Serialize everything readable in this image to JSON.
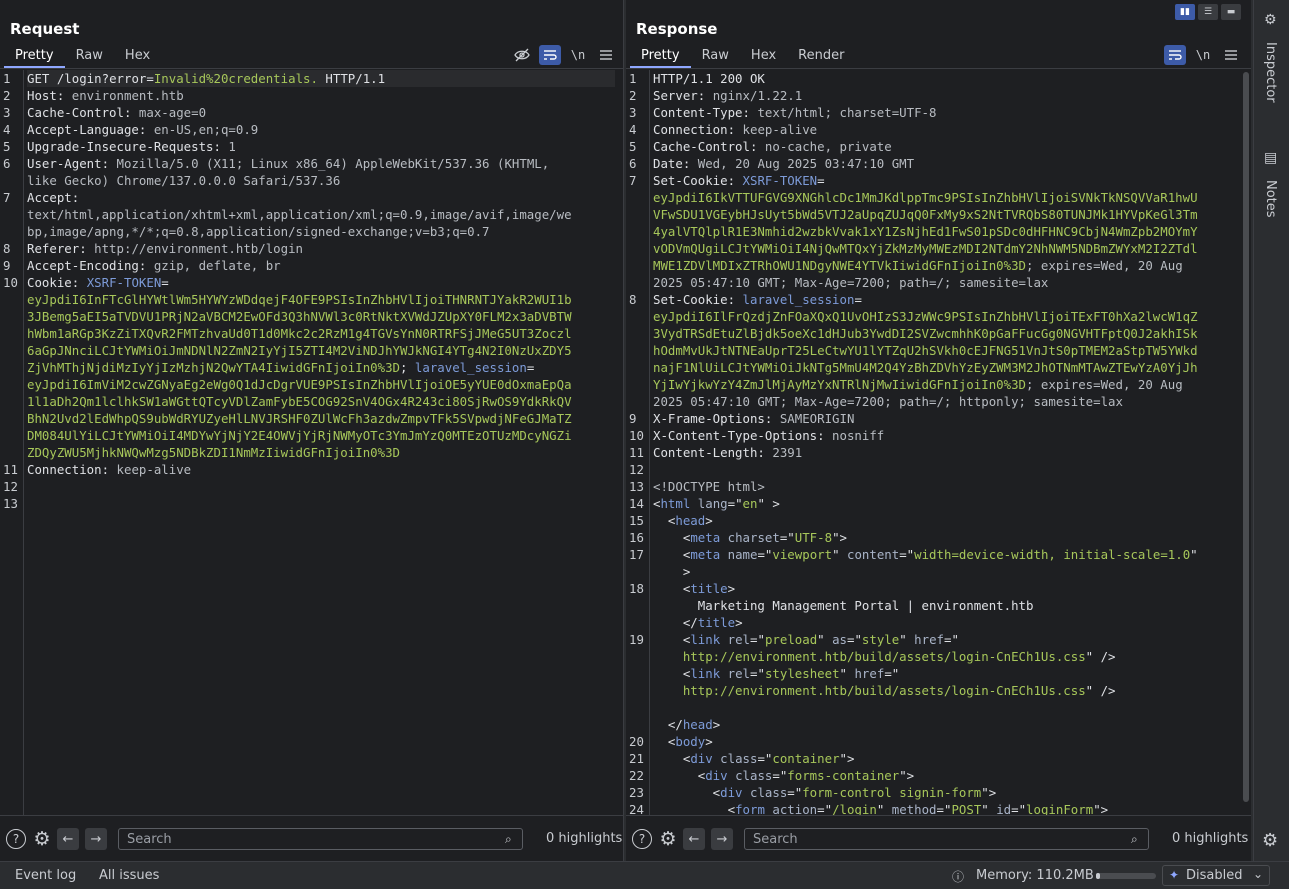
{
  "request": {
    "title": "Request",
    "tabs": [
      "Pretty",
      "Raw",
      "Hex"
    ],
    "active_tab": "Pretty",
    "toolbar": {
      "hide_icon": "eye-slash-icon",
      "wrap_icon": "wrap-icon",
      "newline": "\\n",
      "menu_icon": "menu-icon"
    },
    "lines": [
      {
        "n": "1",
        "segs": [
          {
            "t": "GET /login?",
            "c": "k"
          },
          {
            "t": "error=",
            "c": "k"
          },
          {
            "t": "Invalid%20credentials.",
            "c": "g"
          },
          {
            "t": " HTTP/1.1",
            "c": "k"
          }
        ]
      },
      {
        "n": "2",
        "segs": [
          {
            "t": "Host: ",
            "c": "k"
          },
          {
            "t": "environment.htb",
            "c": "v"
          }
        ]
      },
      {
        "n": "3",
        "segs": [
          {
            "t": "Cache-Control: ",
            "c": "k"
          },
          {
            "t": "max-age=0",
            "c": "v"
          }
        ]
      },
      {
        "n": "4",
        "segs": [
          {
            "t": "Accept-Language: ",
            "c": "k"
          },
          {
            "t": "en-US,en;q=0.9",
            "c": "v"
          }
        ]
      },
      {
        "n": "5",
        "segs": [
          {
            "t": "Upgrade-Insecure-Requests: ",
            "c": "k"
          },
          {
            "t": "1",
            "c": "v"
          }
        ]
      },
      {
        "n": "6",
        "segs": [
          {
            "t": "User-Agent: ",
            "c": "k"
          },
          {
            "t": "Mozilla/5.0 (X11; Linux x86_64) AppleWebKit/537.36 (KHTML,",
            "c": "v"
          }
        ]
      },
      {
        "n": "",
        "segs": [
          {
            "t": "like Gecko) Chrome/137.0.0.0 Safari/537.36",
            "c": "v"
          }
        ]
      },
      {
        "n": "7",
        "segs": [
          {
            "t": "Accept:",
            "c": "k"
          }
        ]
      },
      {
        "n": "",
        "segs": [
          {
            "t": "text/html,application/xhtml+xml,application/xml;q=0.9,image/avif,image/we",
            "c": "v"
          }
        ]
      },
      {
        "n": "",
        "segs": [
          {
            "t": "bp,image/apng,*/*;q=0.8,application/signed-exchange;v=b3;q=0.7",
            "c": "v"
          }
        ]
      },
      {
        "n": "8",
        "segs": [
          {
            "t": "Referer: ",
            "c": "k"
          },
          {
            "t": "http://environment.htb/login",
            "c": "v"
          }
        ]
      },
      {
        "n": "9",
        "segs": [
          {
            "t": "Accept-Encoding: ",
            "c": "k"
          },
          {
            "t": "gzip, deflate, br",
            "c": "v"
          }
        ]
      },
      {
        "n": "10",
        "segs": [
          {
            "t": "Cookie: ",
            "c": "k"
          },
          {
            "t": "XSRF-TOKEN",
            "c": "tag"
          },
          {
            "t": "=",
            "c": "k"
          }
        ]
      },
      {
        "n": "",
        "segs": [
          {
            "t": "eyJpdiI6InFTcGlHYWtlWm5HYWYzWDdqejF4OFE9PSIsInZhbHVlIjoiTHNRNTJYakR2WUI1b",
            "c": "g"
          }
        ]
      },
      {
        "n": "",
        "segs": [
          {
            "t": "3JBemg5aEI5aTVDVU1PRjN2aVBCM2EwOFd3Q3hNVWl3c0RtNktXVWdJZUpXY0FLM2x3aDVBTW",
            "c": "g"
          }
        ]
      },
      {
        "n": "",
        "segs": [
          {
            "t": "hWbm1aRGp3KzZiTXQvR2FMTzhvaUd0T1d0Mkc2c2RzM1g4TGVsYnN0RTRFSjJMeG5UT3Zoczl",
            "c": "g"
          }
        ]
      },
      {
        "n": "",
        "segs": [
          {
            "t": "6aGpJNnciLCJtYWMiOiJmNDNlN2ZmN2IyYjI5ZTI4M2ViNDJhYWJkNGI4YTg4N2I0NzUxZDY5",
            "c": "g"
          }
        ]
      },
      {
        "n": "",
        "segs": [
          {
            "t": "ZjVhMThjNjdiMzIyYjIzMzhjN2QwYTA4IiwidGFnIjoiIn0%3D",
            "c": "g"
          },
          {
            "t": "; ",
            "c": "k"
          },
          {
            "t": "laravel_session",
            "c": "tag"
          },
          {
            "t": "=",
            "c": "k"
          }
        ]
      },
      {
        "n": "",
        "segs": [
          {
            "t": "eyJpdiI6ImViM2cwZGNyaEg2eWg0Q1dJcDgrVUE9PSIsInZhbHVlIjoiOE5yYUE0dOxmaEpQa",
            "c": "g"
          }
        ]
      },
      {
        "n": "",
        "segs": [
          {
            "t": "1l1aDh2Qm1lclhkSW1aWGttQTcyVDlZamFybE5COG92SnV4OGx4R243ci80SjRwOS9YdkRkQV",
            "c": "g"
          }
        ]
      },
      {
        "n": "",
        "segs": [
          {
            "t": "BhN2Uvd2lEdWhpQS9ubWdRYUZyeHlLNVJRSHF0ZUlWcFh3azdwZmpvTFk5SVpwdjNFeGJMaTZ",
            "c": "g"
          }
        ]
      },
      {
        "n": "",
        "segs": [
          {
            "t": "DM084UlYiLCJtYWMiOiI4MDYwYjNjY2E4OWVjYjRjNWMyOTc3YmJmYzQ0MTEzOTUzMDcyNGZi",
            "c": "g"
          }
        ]
      },
      {
        "n": "",
        "segs": [
          {
            "t": "ZDQyZWU5MjhkNWQwMzg5NDBkZDI1NmMzIiwidGFnIjoiIn0%3D",
            "c": "g"
          }
        ]
      },
      {
        "n": "11",
        "segs": [
          {
            "t": "Connection: ",
            "c": "k"
          },
          {
            "t": "keep-alive",
            "c": "v"
          }
        ]
      },
      {
        "n": "12",
        "segs": []
      },
      {
        "n": "13",
        "segs": []
      }
    ],
    "search_placeholder": "Search",
    "highlights": "0 highlights"
  },
  "response": {
    "title": "Response",
    "tabs": [
      "Pretty",
      "Raw",
      "Hex",
      "Render"
    ],
    "active_tab": "Pretty",
    "toolbar": {
      "wrap_icon": "wrap-icon",
      "newline": "\\n",
      "menu_icon": "menu-icon"
    },
    "lines": [
      {
        "n": "1",
        "segs": [
          {
            "t": "HTTP/1.1 200 OK",
            "c": "k"
          }
        ]
      },
      {
        "n": "2",
        "segs": [
          {
            "t": "Server: ",
            "c": "k"
          },
          {
            "t": "nginx/1.22.1",
            "c": "v"
          }
        ]
      },
      {
        "n": "3",
        "segs": [
          {
            "t": "Content-Type: ",
            "c": "k"
          },
          {
            "t": "text/html; charset=UTF-8",
            "c": "v"
          }
        ]
      },
      {
        "n": "4",
        "segs": [
          {
            "t": "Connection: ",
            "c": "k"
          },
          {
            "t": "keep-alive",
            "c": "v"
          }
        ]
      },
      {
        "n": "5",
        "segs": [
          {
            "t": "Cache-Control: ",
            "c": "k"
          },
          {
            "t": "no-cache, private",
            "c": "v"
          }
        ]
      },
      {
        "n": "6",
        "segs": [
          {
            "t": "Date: ",
            "c": "k"
          },
          {
            "t": "Wed, 20 Aug 2025 03:47:10 GMT",
            "c": "v"
          }
        ]
      },
      {
        "n": "7",
        "segs": [
          {
            "t": "Set-Cookie: ",
            "c": "k"
          },
          {
            "t": "XSRF-TOKEN",
            "c": "tag"
          },
          {
            "t": "=",
            "c": "k"
          }
        ]
      },
      {
        "n": "",
        "segs": [
          {
            "t": "eyJpdiI6IkVTTUFGVG9XNGhlcDc1MmJKdlppTmc9PSIsInZhbHVlIjoiSVNkTkNSQVVaR1hwU",
            "c": "g"
          }
        ]
      },
      {
        "n": "",
        "segs": [
          {
            "t": "VFwSDU1VGEybHJsUyt5bWd5VTJ2aUpqZUJqQ0FxMy9xS2NtTVRQbS80TUNJMk1HYVpKeGl3Tm",
            "c": "g"
          }
        ]
      },
      {
        "n": "",
        "segs": [
          {
            "t": "4yalVTQlplR1E3Nmhid2wzbkVvak1xY1ZsNjhEd1FwS01pSDc0dHFHNC9CbjN4WmZpb2MOYmY",
            "c": "g"
          }
        ]
      },
      {
        "n": "",
        "segs": [
          {
            "t": "vODVmQUgiLCJtYWMiOiI4NjQwMTQxYjZkMzMyMWEzMDI2NTdmY2NhNWM5NDBmZWYxM2I2ZTdl",
            "c": "g"
          }
        ]
      },
      {
        "n": "",
        "segs": [
          {
            "t": "MWE1ZDVlMDIxZTRhOWU1NDgyNWE4YTVkIiwidGFnIjoiIn0%3D",
            "c": "g"
          },
          {
            "t": "; expires=Wed, 20 Aug",
            "c": "v"
          }
        ]
      },
      {
        "n": "",
        "segs": [
          {
            "t": "2025 05:47:10 GMT; Max-Age=7200; path=/; samesite=lax",
            "c": "v"
          }
        ]
      },
      {
        "n": "8",
        "segs": [
          {
            "t": "Set-Cookie: ",
            "c": "k"
          },
          {
            "t": "laravel_session",
            "c": "tag"
          },
          {
            "t": "=",
            "c": "k"
          }
        ]
      },
      {
        "n": "",
        "segs": [
          {
            "t": "eyJpdiI6IlFrQzdjZnFOaXQxQ1UvOHIzS3JzWWc9PSIsInZhbHVlIjoiTExFT0hXa2lwcW1qZ",
            "c": "g"
          }
        ]
      },
      {
        "n": "",
        "segs": [
          {
            "t": "3VydTRSdEtuZlBjdk5oeXc1dHJub3YwdDI2SVZwcmhhK0pGaFFucGg0NGVHTFptQ0J2akhISk",
            "c": "g"
          }
        ]
      },
      {
        "n": "",
        "segs": [
          {
            "t": "hOdmMvUkJtNTNEaUprT25LeCtwYU1lYTZqU2hSVkh0cEJFNG51VnJtS0pTMEM2aStpTW5YWkd",
            "c": "g"
          }
        ]
      },
      {
        "n": "",
        "segs": [
          {
            "t": "najF1NlUiLCJtYWMiOiJkNTg5MmU4M2Q4YzBhZDVhYzEyZWM3M2JhOTNmMTAwZTEwYzA0YjJh",
            "c": "g"
          }
        ]
      },
      {
        "n": "",
        "segs": [
          {
            "t": "YjIwYjkwYzY4ZmJlMjAyMzYxNTRlNjMwIiwidGFnIjoiIn0%3D",
            "c": "g"
          },
          {
            "t": "; expires=Wed, 20 Aug",
            "c": "v"
          }
        ]
      },
      {
        "n": "",
        "segs": [
          {
            "t": "2025 05:47:10 GMT; Max-Age=7200; path=/; httponly; samesite=lax",
            "c": "v"
          }
        ]
      },
      {
        "n": "9",
        "segs": [
          {
            "t": "X-Frame-Options: ",
            "c": "k"
          },
          {
            "t": "SAMEORIGIN",
            "c": "v"
          }
        ]
      },
      {
        "n": "10",
        "segs": [
          {
            "t": "X-Content-Type-Options: ",
            "c": "k"
          },
          {
            "t": "nosniff",
            "c": "v"
          }
        ]
      },
      {
        "n": "11",
        "segs": [
          {
            "t": "Content-Length: ",
            "c": "k"
          },
          {
            "t": "2391",
            "c": "v"
          }
        ]
      },
      {
        "n": "12",
        "segs": []
      },
      {
        "n": "13",
        "segs": [
          {
            "t": "<!DOCTYPE html>",
            "c": "v"
          }
        ]
      },
      {
        "n": "14",
        "segs": [
          {
            "t": "<",
            "c": "k"
          },
          {
            "t": "html ",
            "c": "tag"
          },
          {
            "t": "lang",
            "c": "attr"
          },
          {
            "t": "=\"",
            "c": "k"
          },
          {
            "t": "en",
            "c": "str"
          },
          {
            "t": "\" >",
            "c": "k"
          }
        ]
      },
      {
        "n": "15",
        "segs": [
          {
            "t": "  <",
            "c": "k"
          },
          {
            "t": "head",
            "c": "tag"
          },
          {
            "t": ">",
            "c": "k"
          }
        ]
      },
      {
        "n": "16",
        "segs": [
          {
            "t": "    <",
            "c": "k"
          },
          {
            "t": "meta ",
            "c": "tag"
          },
          {
            "t": "charset",
            "c": "attr"
          },
          {
            "t": "=\"",
            "c": "k"
          },
          {
            "t": "UTF-8",
            "c": "str"
          },
          {
            "t": "\">",
            "c": "k"
          }
        ]
      },
      {
        "n": "17",
        "segs": [
          {
            "t": "    <",
            "c": "k"
          },
          {
            "t": "meta ",
            "c": "tag"
          },
          {
            "t": "name",
            "c": "attr"
          },
          {
            "t": "=\"",
            "c": "k"
          },
          {
            "t": "viewport",
            "c": "str"
          },
          {
            "t": "\" ",
            "c": "k"
          },
          {
            "t": "content",
            "c": "attr"
          },
          {
            "t": "=\"",
            "c": "k"
          },
          {
            "t": "width=device-width, initial-scale=1.0",
            "c": "str"
          },
          {
            "t": "\"",
            "c": "k"
          }
        ]
      },
      {
        "n": "",
        "segs": [
          {
            "t": "    >",
            "c": "k"
          }
        ]
      },
      {
        "n": "18",
        "segs": [
          {
            "t": "    <",
            "c": "k"
          },
          {
            "t": "title",
            "c": "tag"
          },
          {
            "t": ">",
            "c": "k"
          }
        ]
      },
      {
        "n": "",
        "segs": [
          {
            "t": "      Marketing Management Portal | environment.htb",
            "c": "k"
          }
        ]
      },
      {
        "n": "",
        "segs": [
          {
            "t": "    </",
            "c": "k"
          },
          {
            "t": "title",
            "c": "tag"
          },
          {
            "t": ">",
            "c": "k"
          }
        ]
      },
      {
        "n": "19",
        "segs": [
          {
            "t": "    <",
            "c": "k"
          },
          {
            "t": "link ",
            "c": "tag"
          },
          {
            "t": "rel",
            "c": "attr"
          },
          {
            "t": "=\"",
            "c": "k"
          },
          {
            "t": "preload",
            "c": "str"
          },
          {
            "t": "\" ",
            "c": "k"
          },
          {
            "t": "as",
            "c": "attr"
          },
          {
            "t": "=\"",
            "c": "k"
          },
          {
            "t": "style",
            "c": "str"
          },
          {
            "t": "\" ",
            "c": "k"
          },
          {
            "t": "href",
            "c": "attr"
          },
          {
            "t": "=\"",
            "c": "k"
          }
        ]
      },
      {
        "n": "",
        "segs": [
          {
            "t": "    http://environment.htb/build/assets/login-CnECh1Us.css",
            "c": "str"
          },
          {
            "t": "\" />",
            "c": "k"
          }
        ]
      },
      {
        "n": "",
        "segs": [
          {
            "t": "    <",
            "c": "k"
          },
          {
            "t": "link ",
            "c": "tag"
          },
          {
            "t": "rel",
            "c": "attr"
          },
          {
            "t": "=\"",
            "c": "k"
          },
          {
            "t": "stylesheet",
            "c": "str"
          },
          {
            "t": "\" ",
            "c": "k"
          },
          {
            "t": "href",
            "c": "attr"
          },
          {
            "t": "=\"",
            "c": "k"
          }
        ]
      },
      {
        "n": "",
        "segs": [
          {
            "t": "    http://environment.htb/build/assets/login-CnECh1Us.css",
            "c": "str"
          },
          {
            "t": "\" />",
            "c": "k"
          }
        ]
      },
      {
        "n": "",
        "segs": []
      },
      {
        "n": "",
        "segs": [
          {
            "t": "  </",
            "c": "k"
          },
          {
            "t": "head",
            "c": "tag"
          },
          {
            "t": ">",
            "c": "k"
          }
        ]
      },
      {
        "n": "20",
        "segs": [
          {
            "t": "  <",
            "c": "k"
          },
          {
            "t": "body",
            "c": "tag"
          },
          {
            "t": ">",
            "c": "k"
          }
        ]
      },
      {
        "n": "21",
        "segs": [
          {
            "t": "    <",
            "c": "k"
          },
          {
            "t": "div ",
            "c": "tag"
          },
          {
            "t": "class",
            "c": "attr"
          },
          {
            "t": "=\"",
            "c": "k"
          },
          {
            "t": "container",
            "c": "str"
          },
          {
            "t": "\">",
            "c": "k"
          }
        ]
      },
      {
        "n": "22",
        "segs": [
          {
            "t": "      <",
            "c": "k"
          },
          {
            "t": "div ",
            "c": "tag"
          },
          {
            "t": "class",
            "c": "attr"
          },
          {
            "t": "=\"",
            "c": "k"
          },
          {
            "t": "forms-container",
            "c": "str"
          },
          {
            "t": "\">",
            "c": "k"
          }
        ]
      },
      {
        "n": "23",
        "segs": [
          {
            "t": "        <",
            "c": "k"
          },
          {
            "t": "div ",
            "c": "tag"
          },
          {
            "t": "class",
            "c": "attr"
          },
          {
            "t": "=\"",
            "c": "k"
          },
          {
            "t": "form-control signin-form",
            "c": "str"
          },
          {
            "t": "\">",
            "c": "k"
          }
        ]
      },
      {
        "n": "24",
        "segs": [
          {
            "t": "          <",
            "c": "k"
          },
          {
            "t": "form ",
            "c": "tag"
          },
          {
            "t": "action",
            "c": "attr"
          },
          {
            "t": "=\"",
            "c": "k"
          },
          {
            "t": "/login",
            "c": "str"
          },
          {
            "t": "\" ",
            "c": "k"
          },
          {
            "t": "method",
            "c": "attr"
          },
          {
            "t": "=\"",
            "c": "k"
          },
          {
            "t": "POST",
            "c": "str"
          },
          {
            "t": "\" ",
            "c": "k"
          },
          {
            "t": "id",
            "c": "attr"
          },
          {
            "t": "=\"",
            "c": "k"
          },
          {
            "t": "loginForm",
            "c": "str"
          },
          {
            "t": "\">",
            "c": "k"
          }
        ]
      }
    ],
    "search_placeholder": "Search",
    "highlights": "0 highlights"
  },
  "right_rail": {
    "inspector": "Inspector",
    "notes": "Notes"
  },
  "statusbar": {
    "event_log": "Event log",
    "all_issues": "All issues",
    "memory": "Memory: 110.2MB",
    "memory_fill": 0.06,
    "mode": "Disabled"
  }
}
